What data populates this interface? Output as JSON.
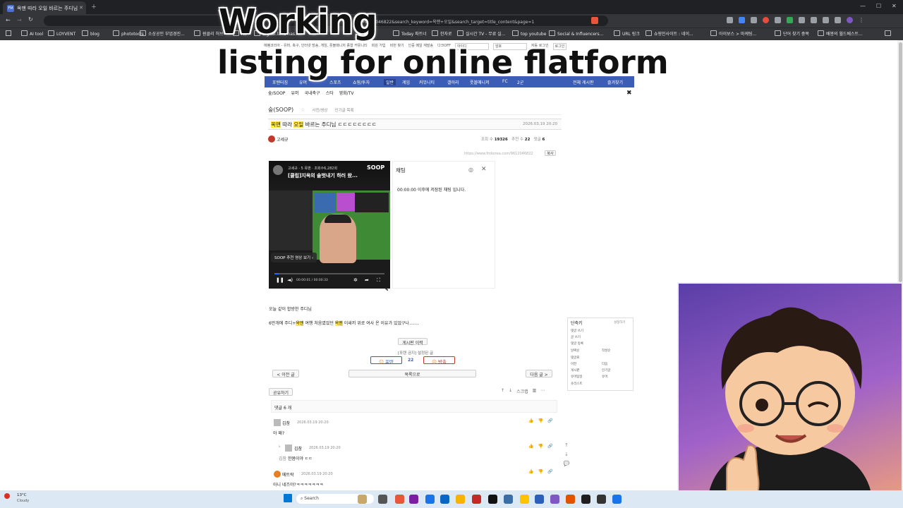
{
  "browser": {
    "tab_title": "옥맨 따라 오일 바르는 주디님",
    "tab_favicon": "FM",
    "url": "=9612046822&search_keyword=옥맨+오일&search_target=title_content&page=1",
    "bookmarks": [
      "AI tool",
      "LOYVENT",
      "blog",
      "phototools",
      "소상공인 부업경진...",
      "원클리 허브",
      "All",
      "digital.land has...",
      "Today 파트너",
      "한자로",
      "실시간 TV - 무료 실...",
      "top youtube",
      "Social & Influencers...",
      "URL 링크",
      "쇼핑인사이트 : 네이...",
      "아이보스 > 마케팅...",
      "단어 찾기 중복",
      "배봉의 월드베스트..."
    ]
  },
  "overlay": {
    "line1": "Working",
    "line2": "listing for online flatform"
  },
  "site": {
    "top_links": [
      "에펨코리아 - 유머, 축구, 인터넷 방송, 게임, 풋볼매니저 종합 커뮤니티",
      "회원 가입",
      "비번 찾기",
      "인증 메일 재발송",
      "다크OFF",
      "아이디",
      "암호",
      "자동 로그인",
      "로그인"
    ],
    "nav": [
      "포텐터짐",
      "유머",
      "스포츠",
      "쇼핑/투자",
      "일반",
      "게임",
      "커뮤니티",
      "갤러리",
      "풋볼매니저",
      "FC",
      "2군",
      "전체 게시판",
      "즐겨찾기"
    ],
    "subnav": [
      "숲/SOOP",
      "유머",
      "국내축구",
      "스타",
      "영화/TV"
    ],
    "board_name": "숲(SOOP)",
    "board_links": [
      "사진/영상",
      "인기글 목록"
    ],
    "post": {
      "title_parts": [
        {
          "text": "옥맨",
          "hl": true
        },
        {
          "text": " 따라 ",
          "hl": false
        },
        {
          "text": "오일",
          "hl": true
        },
        {
          "text": " 바르는 주디님 ㄷㄷㄷㄷㄷㄷㄷㄷ",
          "hl": false
        }
      ],
      "date": "2026.03.19 20:20",
      "author": "고세규",
      "views_label": "조회 수",
      "views": "19326",
      "likes_label": "추천 수",
      "likes": "22",
      "comments_label": "댓글",
      "comments": "6",
      "permalink": "https://www.fmkorea.com/9612046822",
      "copy_label": "복사"
    },
    "video": {
      "channel": "고세규",
      "meta": "· 5 옥맨 · 조회수6,282회",
      "title": "[클립]지옥의 솔벗내기 하러 왔...",
      "brand": "SOOP",
      "recommend": "SOOP 추천 영상 보기",
      "time": "00:00:01 / 00:00:33"
    },
    "chat": {
      "title": "채팅",
      "notice": "00:00:00 이후에 저장된 채팅 입니다."
    },
    "body": {
      "line1": "오늘 같이 합방한 주디님",
      "line2_parts": [
        {
          "text": "6만개에 주디+",
          "hl": false
        },
        {
          "text": "옥맨",
          "hl": true
        },
        {
          "text": " 여행 처음였었던 ",
          "hl": false
        },
        {
          "text": "옥맨",
          "hl": true
        },
        {
          "text": " 이새끼 위로 여사 온 이유가 있었구나.......",
          "hl": false
        }
      ]
    },
    "actions": {
      "history": "게시판 이력",
      "notice": "[포텐 금지] 설정된 글",
      "poten": "포텐",
      "count": "22",
      "report": "방출",
      "prev": "< 이전 글",
      "list": "목록으로",
      "next": "다음 글 >",
      "share": "공유하기",
      "scrap": "스크랩"
    },
    "shortcuts": {
      "title": "단축키",
      "settings": "설정하기",
      "items": [
        "댓글 쓰기",
        "글 쓰기",
        "댓글 등록",
        "날짜순",
        "작성순",
        "댓글로",
        "이전",
        "다음",
        "게시판",
        "인기글",
        "유머탑일",
        "유머",
        "숏리스트"
      ]
    },
    "comments_header": "댓글 6 개",
    "comments": [
      {
        "author": "김참",
        "date": "2026.03.19 20:20",
        "text": "아 왜?"
      },
      {
        "author": "김참",
        "date": "2026.03.19 20:20",
        "reply_to": "김참",
        "text": "한몸이야 ㄷㄷ"
      },
      {
        "author": "메트락",
        "date": "2026.03.19 20:20",
        "text": "아니 네즈야?ㅋㅋㅋㅋㅋㅋㅋ"
      }
    ]
  },
  "taskbar": {
    "weather_temp": "13°C",
    "weather_desc": "Cloudy",
    "search_placeholder": "Search"
  }
}
